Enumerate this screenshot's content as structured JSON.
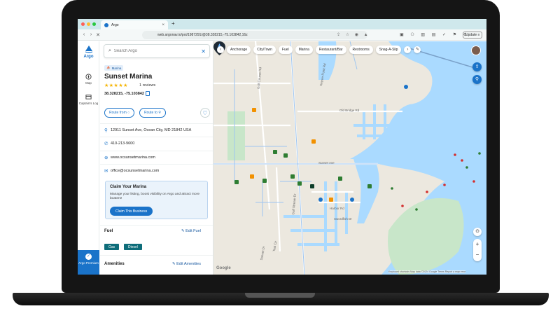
{
  "browser": {
    "tab_title": "Argo",
    "url": "web.argonav.io/poi/1987291/@38.328215,-75.103842,16z",
    "update_label": "Update"
  },
  "rail": {
    "logo": "Argo",
    "items": [
      {
        "label": "Map"
      },
      {
        "label": "Captain's Log"
      }
    ],
    "premium_label": "Argo Premium"
  },
  "panel": {
    "search_placeholder": "Search Argo",
    "category": "Marina",
    "title": "Sunset Marina",
    "rating": 5,
    "reviews": "1 reviews",
    "coords": "38.328215, -75.103842",
    "route_from": "Route from",
    "route_to": "Route to",
    "address": "12911 Sunset Ave, Ocean City, MD 21842 USA",
    "phone": "410-213-9600",
    "website": "www.ocsunsetmarina.com",
    "email": "office@ocsunsetmarina.com",
    "claim": {
      "title": "Claim Your Marina",
      "body": "Manage your listing, boost visibility on Argo and attract more boaters!",
      "button": "Claim This Business"
    },
    "fuel": {
      "title": "Fuel",
      "edit": "Edit Fuel",
      "types": [
        "Gas",
        "Diesel"
      ]
    },
    "amenities": {
      "title": "Amenities",
      "edit": "Edit Amenities"
    }
  },
  "map": {
    "filters": [
      "Anchorage",
      "City/Town",
      "Fuel",
      "Marina",
      "Restaurant/Bar",
      "Restrooms",
      "Snag-A-Slip"
    ],
    "streets": [
      "Old Bridge Rd",
      "Sunset Ave",
      "Harbor Rd",
      "Swordfish Dr",
      "Gulf Stream Dr",
      "Keyser Point Rd",
      "Golf Course Rd",
      "Sunset Dr",
      "Teal Cir"
    ],
    "attribution": "Keyboard shortcuts   Map data ©2024 Google   Terms   Report a map error",
    "google_label": "Google"
  }
}
